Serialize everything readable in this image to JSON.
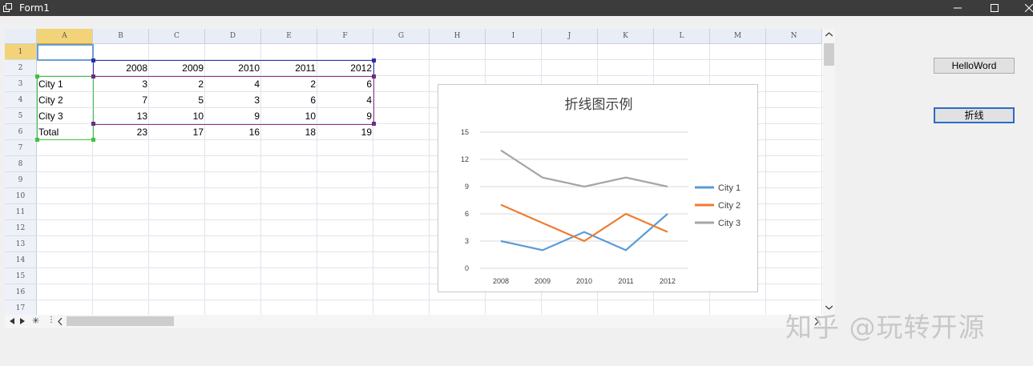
{
  "window": {
    "title": "Form1"
  },
  "buttons": {
    "hello": "HelloWord",
    "line": "折线"
  },
  "sheet": {
    "columns": [
      "A",
      "B",
      "C",
      "D",
      "E",
      "F",
      "G",
      "H",
      "I",
      "J",
      "K",
      "L",
      "M",
      "N"
    ],
    "rows": [
      "1",
      "2",
      "3",
      "4",
      "5",
      "6",
      "7",
      "8",
      "9",
      "10",
      "11",
      "12",
      "13",
      "14",
      "15",
      "16",
      "17"
    ],
    "years": [
      "2008",
      "2009",
      "2010",
      "2011",
      "2012"
    ],
    "data_rows": [
      {
        "label": "City 1",
        "values": [
          "3",
          "2",
          "4",
          "2",
          "6"
        ]
      },
      {
        "label": "City 2",
        "values": [
          "7",
          "5",
          "3",
          "6",
          "4"
        ]
      },
      {
        "label": "City 3",
        "values": [
          "13",
          "10",
          "9",
          "10",
          "9"
        ]
      },
      {
        "label": "Total",
        "values": [
          "23",
          "17",
          "16",
          "18",
          "19"
        ]
      }
    ]
  },
  "chart_data": {
    "type": "line",
    "title": "折线图示例",
    "categories": [
      "2008",
      "2009",
      "2010",
      "2011",
      "2012"
    ],
    "series": [
      {
        "name": "City 1",
        "values": [
          3,
          2,
          4,
          2,
          6
        ],
        "color": "#5b9bd5"
      },
      {
        "name": "City 2",
        "values": [
          7,
          5,
          3,
          6,
          4
        ],
        "color": "#ed7d31"
      },
      {
        "name": "City 3",
        "values": [
          13,
          10,
          9,
          10,
          9
        ],
        "color": "#a5a5a5"
      }
    ],
    "yticks": [
      "0",
      "3",
      "6",
      "9",
      "12",
      "15"
    ],
    "ylim": [
      0,
      15
    ],
    "grid": true,
    "legend": "right"
  },
  "watermark": "知乎 @玩转开源"
}
